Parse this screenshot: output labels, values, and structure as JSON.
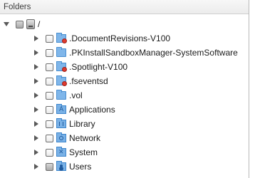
{
  "panel": {
    "header": "Folders"
  },
  "tree": {
    "root": {
      "label": "/",
      "expanded": true,
      "icon": "drive-icon",
      "checkbox": "mixed"
    },
    "children": [
      {
        "label": ".DocumentRevisions-V100",
        "icon": "folder-restricted-icon",
        "checkbox": "unchecked"
      },
      {
        "label": ".PKInstallSandboxManager-SystemSoftware",
        "icon": "folder-icon",
        "checkbox": "unchecked"
      },
      {
        "label": ".Spotlight-V100",
        "icon": "folder-restricted-icon",
        "checkbox": "unchecked"
      },
      {
        "label": ".fseventsd",
        "icon": "folder-restricted-icon",
        "checkbox": "unchecked"
      },
      {
        "label": ".vol",
        "icon": "folder-icon",
        "checkbox": "unchecked"
      },
      {
        "label": "Applications",
        "icon": "apps-folder-icon",
        "checkbox": "unchecked"
      },
      {
        "label": "Library",
        "icon": "library-folder-icon",
        "checkbox": "unchecked"
      },
      {
        "label": "Network",
        "icon": "network-folder-icon",
        "checkbox": "unchecked"
      },
      {
        "label": "System",
        "icon": "system-folder-icon",
        "checkbox": "unchecked"
      },
      {
        "label": "Users",
        "icon": "users-folder-icon",
        "checkbox": "mixed"
      }
    ]
  }
}
